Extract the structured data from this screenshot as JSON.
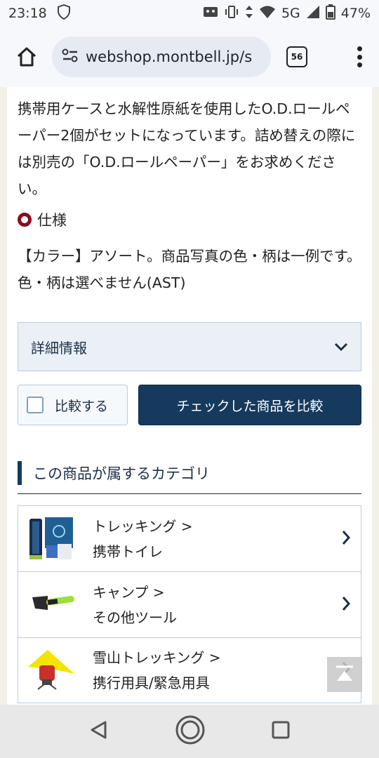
{
  "status_bar": {
    "time": "23:18",
    "network": "5G",
    "battery": "47%"
  },
  "browser": {
    "url": "webshop.montbell.jp/s",
    "tab_count": "56"
  },
  "product": {
    "description": "携帯用ケースと水解性原紙を使用したO.D.ロールペーパー2個がセットになっています。詰め替えの際には別売の「O.D.ロールペーパー」をお求めください。",
    "spec_heading": "仕様",
    "spec_text": "【カラー】アソート。商品写真の色・柄は一例です。色・柄は選べません(AST)"
  },
  "detail": {
    "label": "詳細情報"
  },
  "compare": {
    "checkbox_label": "比較する",
    "button_label": "チェックした商品を比較"
  },
  "categories": {
    "heading": "この商品が属するカテゴリ",
    "items": [
      {
        "line1": "トレッキング >",
        "line2": "携帯トイレ",
        "icon": "toilet-kit-thumbnail"
      },
      {
        "line1": "キャンプ >",
        "line2": "その他ツール",
        "icon": "axe-thumbnail"
      },
      {
        "line1": "雪山トレッキング >",
        "line2": "携行用具/緊急用具",
        "icon": "tent-stove-thumbnail"
      }
    ]
  },
  "colors": {
    "accent_navy": "#163a5e",
    "spec_bullet": "#8a0d1b",
    "page_bg": "#f3f0e6"
  }
}
